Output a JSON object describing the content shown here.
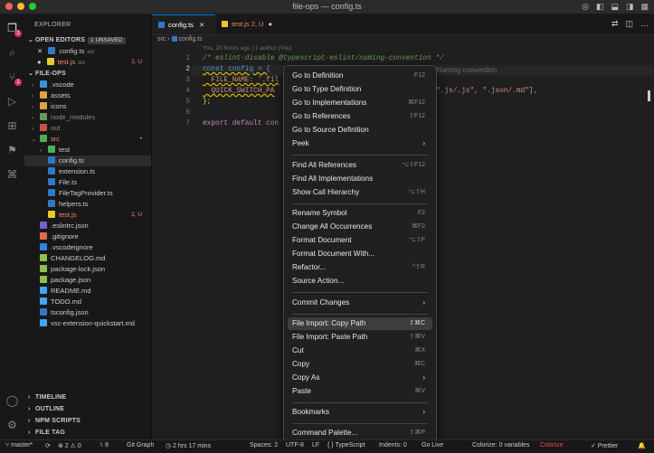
{
  "window": {
    "title": "file-ops — config.ts"
  },
  "activity_bar": {
    "explorer_badge": "1",
    "source_control_badge": "1"
  },
  "sidebar": {
    "title": "EXPLORER",
    "open_editors": {
      "label": "OPEN EDITORS",
      "badge": "1 UNSAVED",
      "items": [
        {
          "name": "config.ts",
          "desc": "src",
          "flag": ""
        },
        {
          "name": "test.js",
          "desc": "src",
          "flag": "2, U"
        }
      ]
    },
    "project": {
      "label": "FILE-OPS",
      "items": [
        {
          "name": ".vscode",
          "flag": ""
        },
        {
          "name": "assets",
          "flag": ""
        },
        {
          "name": "icons",
          "flag": ""
        },
        {
          "name": "node_modules",
          "flag": ""
        },
        {
          "name": "out",
          "flag": ""
        },
        {
          "name": "src",
          "flag": "•"
        },
        {
          "name": "test",
          "flag": ""
        },
        {
          "name": "config.ts",
          "flag": ""
        },
        {
          "name": "extension.ts",
          "flag": ""
        },
        {
          "name": "File.ts",
          "flag": ""
        },
        {
          "name": "FileTagProvider.ts",
          "flag": ""
        },
        {
          "name": "helpers.ts",
          "flag": ""
        },
        {
          "name": "test.js",
          "flag": "2, U"
        },
        {
          "name": ".eslintrc.json",
          "flag": ""
        },
        {
          "name": ".gitignore",
          "flag": ""
        },
        {
          "name": ".vscodeignore",
          "flag": ""
        },
        {
          "name": "CHANGELOG.md",
          "flag": ""
        },
        {
          "name": "package-lock.json",
          "flag": ""
        },
        {
          "name": "package.json",
          "flag": ""
        },
        {
          "name": "README.md",
          "flag": ""
        },
        {
          "name": "TODO.md",
          "flag": ""
        },
        {
          "name": "tsconfig.json",
          "flag": ""
        },
        {
          "name": "vsc-extension-quickstart.md",
          "flag": ""
        }
      ]
    },
    "bottom_sections": [
      "TIMELINE",
      "OUTLINE",
      "NPM SCRIPTS",
      "FILE TAG"
    ]
  },
  "editor": {
    "tabs": [
      {
        "name": "config.ts",
        "flag": ""
      },
      {
        "name": "test.js",
        "flag": "2, U"
      }
    ],
    "breadcrumb": {
      "folder": "src",
      "sep": "›",
      "file": "config.ts"
    },
    "blame": "You, 20 hours ago | 1 author (You)",
    "line_numbers": [
      "1",
      "2",
      "3",
      "4",
      "5",
      "6",
      "7"
    ],
    "lines": [
      "/* eslint-disable @typescript-eslint/naming-convention */",
      "const config = {",
      "  FILE_NAME: '.fil",
      "  QUICK_SWITCH_PA",
      "};",
      "",
      "export default con"
    ],
    "line2_hint": ": Naming convention",
    "line4_tail": "\".js/.js\", \".json/.md\"],"
  },
  "context_menu": {
    "groups": [
      [
        {
          "label": "Go to Definition",
          "shortcut": "F12"
        },
        {
          "label": "Go to Type Definition",
          "shortcut": ""
        },
        {
          "label": "Go to Implementations",
          "shortcut": "⌘F12"
        },
        {
          "label": "Go to References",
          "shortcut": "⇧F12"
        },
        {
          "label": "Go to Source Definition",
          "shortcut": ""
        },
        {
          "label": "Peek",
          "shortcut": "",
          "submenu": true
        }
      ],
      [
        {
          "label": "Find All References",
          "shortcut": "⌥⇧F12"
        },
        {
          "label": "Find All Implementations",
          "shortcut": ""
        },
        {
          "label": "Show Call Hierarchy",
          "shortcut": "⌥⇧H"
        }
      ],
      [
        {
          "label": "Rename Symbol",
          "shortcut": "F2"
        },
        {
          "label": "Change All Occurrences",
          "shortcut": "⌘F2"
        },
        {
          "label": "Format Document",
          "shortcut": "⌥⇧F"
        },
        {
          "label": "Format Document With...",
          "shortcut": ""
        },
        {
          "label": "Refactor...",
          "shortcut": "^⇧R"
        },
        {
          "label": "Source Action...",
          "shortcut": ""
        }
      ],
      [
        {
          "label": "Commit Changes",
          "shortcut": "",
          "submenu": true
        }
      ],
      [
        {
          "label": "File Import: Copy Path",
          "shortcut": "⇧⌘C",
          "highlighted": true
        },
        {
          "label": "File Import: Paste Path",
          "shortcut": "⇧⌘V"
        },
        {
          "label": "Cut",
          "shortcut": "⌘X"
        },
        {
          "label": "Copy",
          "shortcut": "⌘C"
        },
        {
          "label": "Copy As",
          "shortcut": "",
          "submenu": true
        },
        {
          "label": "Paste",
          "shortcut": "⌘V"
        }
      ],
      [
        {
          "label": "Bookmarks",
          "shortcut": "",
          "submenu": true
        }
      ],
      [
        {
          "label": "Command Palette...",
          "shortcut": "⇧⌘P"
        }
      ]
    ]
  },
  "status_bar": {
    "branch": "master*",
    "sync": "⟳",
    "problems": "⊗ 2  ⚠ 0",
    "ports": "⑊ 8",
    "git_graph": "Git Graph",
    "time": "◷ 2 hrs 17 mins",
    "spaces": "Spaces: 2",
    "encoding": "UTF-8",
    "eol": "LF",
    "language": "{ } TypeScript",
    "indents": "Indents: 0",
    "live": "Go Live",
    "colorize_vars": "Colorize: 0 variables",
    "colorize": "Colorize",
    "prettier": "✓ Prettier",
    "bell": "🔔"
  },
  "colors": {
    "accent": "#0078d4",
    "badge": "#d6336c",
    "error": "#f48771"
  }
}
